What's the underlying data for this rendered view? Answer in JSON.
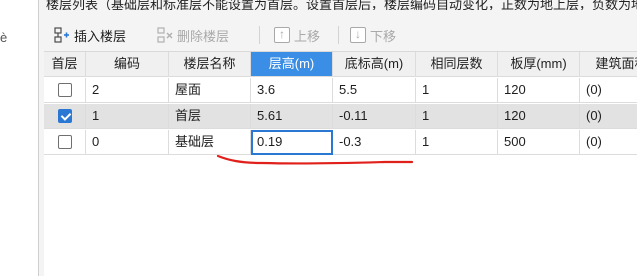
{
  "header": {
    "text": "楼层列表（基础层和标准层不能设置为首层。设置首层后，楼层编码自动变化，正数为地上层，负数为地下层）"
  },
  "left_panel": {
    "sliver_text": "è"
  },
  "toolbar": {
    "insert_label": "插入楼层",
    "delete_label": "删除楼层",
    "up_label": "上移",
    "down_label": "下移"
  },
  "table": {
    "headers": [
      "首层",
      "编码",
      "楼层名称",
      "层高(m)",
      "底标高(m)",
      "相同层数",
      "板厚(mm)",
      "建筑面积"
    ],
    "active_header": "层高(m)",
    "rows": [
      {
        "first": false,
        "code": "2",
        "name": "屋面",
        "height": "3.6",
        "bottom": "5.5",
        "same": "1",
        "thickness": "120",
        "area": "(0)"
      },
      {
        "first": true,
        "code": "1",
        "name": "首层",
        "height": "5.61",
        "bottom": "-0.11",
        "same": "1",
        "thickness": "120",
        "area": "(0)"
      },
      {
        "first": false,
        "code": "0",
        "name": "基础层",
        "height": "0.19",
        "bottom": "-0.3",
        "same": "1",
        "thickness": "500",
        "area": "(0)"
      }
    ]
  },
  "colors": {
    "accent": "#3a8ee6",
    "checkbox": "#2b78d4",
    "annotation": "#e0201a"
  }
}
